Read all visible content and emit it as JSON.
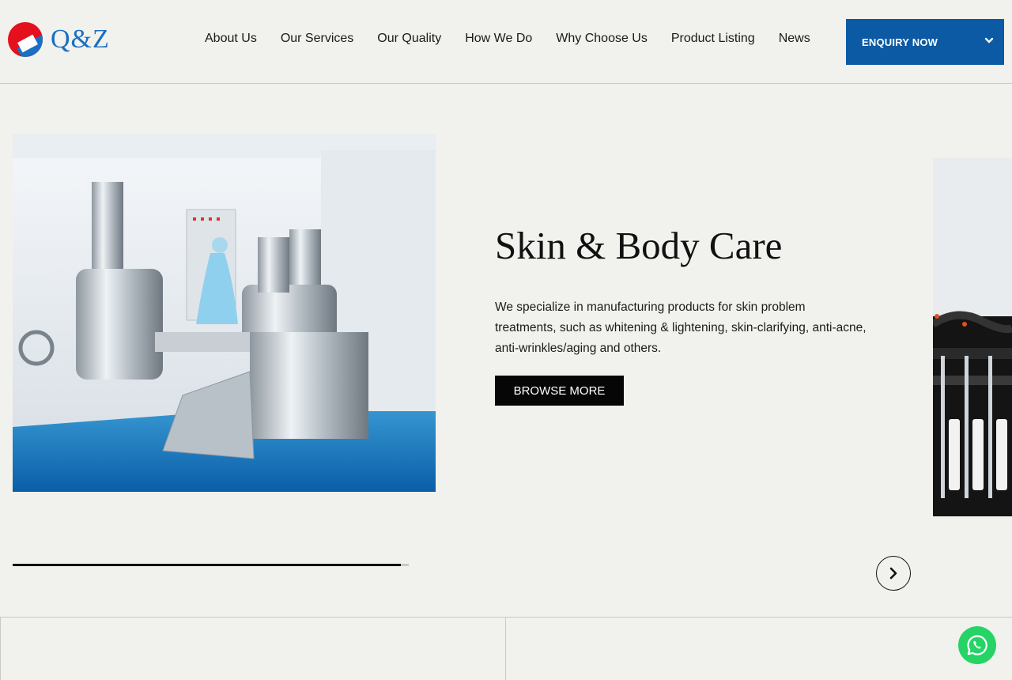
{
  "header": {
    "logo_text": "Q&Z",
    "nav": [
      "About Us",
      "Our Services",
      "Our Quality",
      "How We Do",
      "Why Choose Us",
      "Product Listing",
      "News"
    ],
    "enquiry_label": "ENQUIRY NOW"
  },
  "slide": {
    "title": "Skin & Body Care",
    "description": "We specialize in manufacturing products for skin problem treatments, such as whitening & lightening, skin-clarifying, anti-acne, anti-wrinkles/aging and others.",
    "button_label": "BROWSE MORE",
    "progress": 0.98
  },
  "colors": {
    "background": "#f1f1ed",
    "brand_blue": "#0c5aa3",
    "logo_red": "#e4101e",
    "whatsapp_green": "#26d366"
  },
  "icons": [
    "logo-mark-icon",
    "chevron-down-icon",
    "chevron-right-icon",
    "whatsapp-icon"
  ]
}
